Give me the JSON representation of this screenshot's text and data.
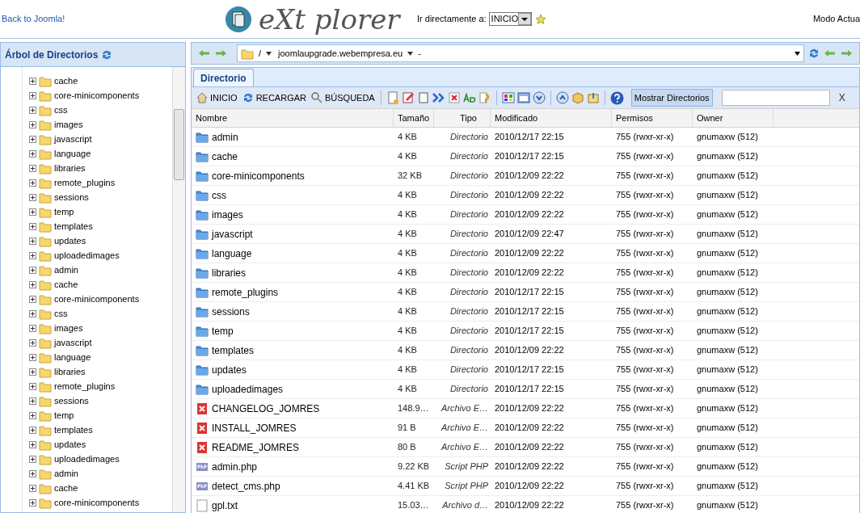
{
  "header": {
    "back_link": "Back to Joomla!",
    "logo": "eXt plorer",
    "goto_label": "Ir directamente a:",
    "goto_value": "INICIO",
    "mode": "Modo Actua"
  },
  "tree": {
    "title": "Árbol de Directorios",
    "items": [
      "cache",
      "core-minicomponents",
      "css",
      "images",
      "javascript",
      "language",
      "libraries",
      "remote_plugins",
      "sessions",
      "temp",
      "templates",
      "updates",
      "uploadedimages",
      "admin",
      "cache",
      "core-minicomponents",
      "css",
      "images",
      "javascript",
      "language",
      "libraries",
      "remote_plugins",
      "sessions",
      "temp",
      "templates",
      "updates",
      "uploadedimages",
      "admin",
      "cache",
      "core-minicomponents"
    ]
  },
  "path_bar": {
    "root": "/",
    "site": "joomlaupgrade.webempresa.eu",
    "rest": "-"
  },
  "tabs": [
    {
      "label": "Directorio",
      "selected": true
    }
  ],
  "toolbar": {
    "buttons": [
      {
        "kind": "home",
        "label": "INICIO"
      },
      {
        "kind": "reload",
        "label": "RECARGAR"
      },
      {
        "kind": "search",
        "label": "BÚSQUEDA"
      }
    ],
    "toggle": "Mostrar Directorios",
    "close": "X"
  },
  "table": {
    "columns": [
      "Nombre",
      "Tamaño",
      "Tipo",
      "Modificado",
      "Permisos",
      "Owner"
    ],
    "rows": [
      {
        "kind": "dir",
        "name": "admin",
        "size": "4 KB",
        "type": "Directorio",
        "modified": "2010/12/17 22:15",
        "perms": "755 (rwxr-xr-x)",
        "owner": "gnumaxw (512)"
      },
      {
        "kind": "dir",
        "name": "cache",
        "size": "4 KB",
        "type": "Directorio",
        "modified": "2010/12/17 22:15",
        "perms": "755 (rwxr-xr-x)",
        "owner": "gnumaxw (512)"
      },
      {
        "kind": "dir",
        "name": "core-minicomponents",
        "size": "32 KB",
        "type": "Directorio",
        "modified": "2010/12/09 22:22",
        "perms": "755 (rwxr-xr-x)",
        "owner": "gnumaxw (512)"
      },
      {
        "kind": "dir",
        "name": "css",
        "size": "4 KB",
        "type": "Directorio",
        "modified": "2010/12/09 22:22",
        "perms": "755 (rwxr-xr-x)",
        "owner": "gnumaxw (512)"
      },
      {
        "kind": "dir",
        "name": "images",
        "size": "4 KB",
        "type": "Directorio",
        "modified": "2010/12/09 22:22",
        "perms": "755 (rwxr-xr-x)",
        "owner": "gnumaxw (512)"
      },
      {
        "kind": "dir",
        "name": "javascript",
        "size": "4 KB",
        "type": "Directorio",
        "modified": "2010/12/09 22:47",
        "perms": "755 (rwxr-xr-x)",
        "owner": "gnumaxw (512)"
      },
      {
        "kind": "dir",
        "name": "language",
        "size": "4 KB",
        "type": "Directorio",
        "modified": "2010/12/09 22:22",
        "perms": "755 (rwxr-xr-x)",
        "owner": "gnumaxw (512)"
      },
      {
        "kind": "dir",
        "name": "libraries",
        "size": "4 KB",
        "type": "Directorio",
        "modified": "2010/12/09 22:22",
        "perms": "755 (rwxr-xr-x)",
        "owner": "gnumaxw (512)"
      },
      {
        "kind": "dir",
        "name": "remote_plugins",
        "size": "4 KB",
        "type": "Directorio",
        "modified": "2010/12/17 22:15",
        "perms": "755 (rwxr-xr-x)",
        "owner": "gnumaxw (512)"
      },
      {
        "kind": "dir",
        "name": "sessions",
        "size": "4 KB",
        "type": "Directorio",
        "modified": "2010/12/17 22:15",
        "perms": "755 (rwxr-xr-x)",
        "owner": "gnumaxw (512)"
      },
      {
        "kind": "dir",
        "name": "temp",
        "size": "4 KB",
        "type": "Directorio",
        "modified": "2010/12/17 22:15",
        "perms": "755 (rwxr-xr-x)",
        "owner": "gnumaxw (512)"
      },
      {
        "kind": "dir",
        "name": "templates",
        "size": "4 KB",
        "type": "Directorio",
        "modified": "2010/12/09 22:22",
        "perms": "755 (rwxr-xr-x)",
        "owner": "gnumaxw (512)"
      },
      {
        "kind": "dir",
        "name": "updates",
        "size": "4 KB",
        "type": "Directorio",
        "modified": "2010/12/17 22:15",
        "perms": "755 (rwxr-xr-x)",
        "owner": "gnumaxw (512)"
      },
      {
        "kind": "dir",
        "name": "uploadedimages",
        "size": "4 KB",
        "type": "Directorio",
        "modified": "2010/12/17 22:15",
        "perms": "755 (rwxr-xr-x)",
        "owner": "gnumaxw (512)"
      },
      {
        "kind": "jomres",
        "name": "CHANGELOG_JOMRES",
        "size": "148.9…",
        "type": "Archivo E…",
        "modified": "2010/12/09 22:22",
        "perms": "755 (rwxr-xr-x)",
        "owner": "gnumaxw (512)"
      },
      {
        "kind": "jomres",
        "name": "INSTALL_JOMRES",
        "size": "91 B",
        "type": "Archivo E…",
        "modified": "2010/12/09 22:22",
        "perms": "755 (rwxr-xr-x)",
        "owner": "gnumaxw (512)"
      },
      {
        "kind": "jomres",
        "name": "README_JOMRES",
        "size": "80 B",
        "type": "Archivo E…",
        "modified": "2010/12/09 22:22",
        "perms": "755 (rwxr-xr-x)",
        "owner": "gnumaxw (512)"
      },
      {
        "kind": "php",
        "name": "admin.php",
        "size": "9.22 KB",
        "type": "Script PHP",
        "modified": "2010/12/09 22:22",
        "perms": "755 (rwxr-xr-x)",
        "owner": "gnumaxw (512)"
      },
      {
        "kind": "php",
        "name": "detect_cms.php",
        "size": "4.41 KB",
        "type": "Script PHP",
        "modified": "2010/12/09 22:22",
        "perms": "755 (rwxr-xr-x)",
        "owner": "gnumaxw (512)"
      },
      {
        "kind": "txt",
        "name": "gpl.txt",
        "size": "15.03…",
        "type": "Archivo d…",
        "modified": "2010/12/09 22:22",
        "perms": "755 (rwxr-xr-x)",
        "owner": "gnumaxw (512)"
      }
    ]
  }
}
